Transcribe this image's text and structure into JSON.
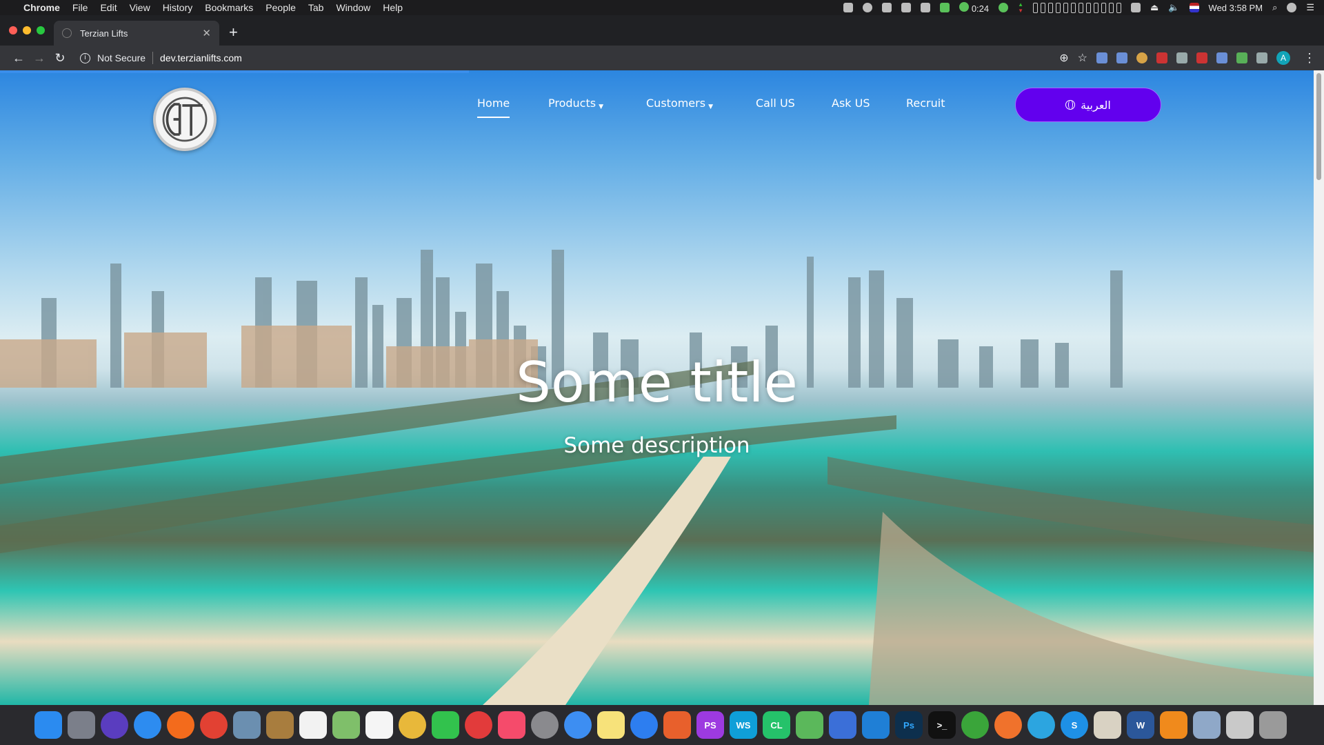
{
  "menubar": {
    "app_name": "Chrome",
    "menus": [
      "File",
      "Edit",
      "View",
      "History",
      "Bookmarks",
      "People",
      "Tab",
      "Window",
      "Help"
    ],
    "battery_time": "0:24",
    "clock": "Wed 3:58 PM"
  },
  "browser": {
    "tab_title": "Terzian Lifts",
    "security_label": "Not Secure",
    "url": "dev.terzianlifts.com",
    "profile_initial": "A"
  },
  "site": {
    "nav": {
      "home": "Home",
      "products": "Products",
      "customers": "Customers",
      "call_us": "Call US",
      "ask_us": "Ask US",
      "recruit": "Recruit"
    },
    "language_button": "العربية",
    "hero": {
      "title": "Some title",
      "description": "Some description"
    }
  },
  "colors": {
    "language_button": "#6200ee",
    "progress": "#3a8eeb"
  }
}
